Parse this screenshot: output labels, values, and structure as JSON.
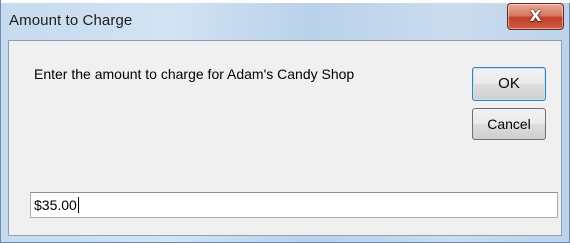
{
  "window": {
    "title": "Amount to Charge",
    "close_icon": "close-icon",
    "close_glyph": "X"
  },
  "dialog": {
    "prompt": "Enter the amount to charge for Adam's Candy Shop",
    "ok_label": "OK",
    "cancel_label": "Cancel",
    "amount_value": "$35.00"
  },
  "colors": {
    "title_bar": "#c6dbef",
    "close_button": "#c2402a",
    "client_background": "#f0f0f0",
    "default_button_border": "#3c7fb1"
  }
}
